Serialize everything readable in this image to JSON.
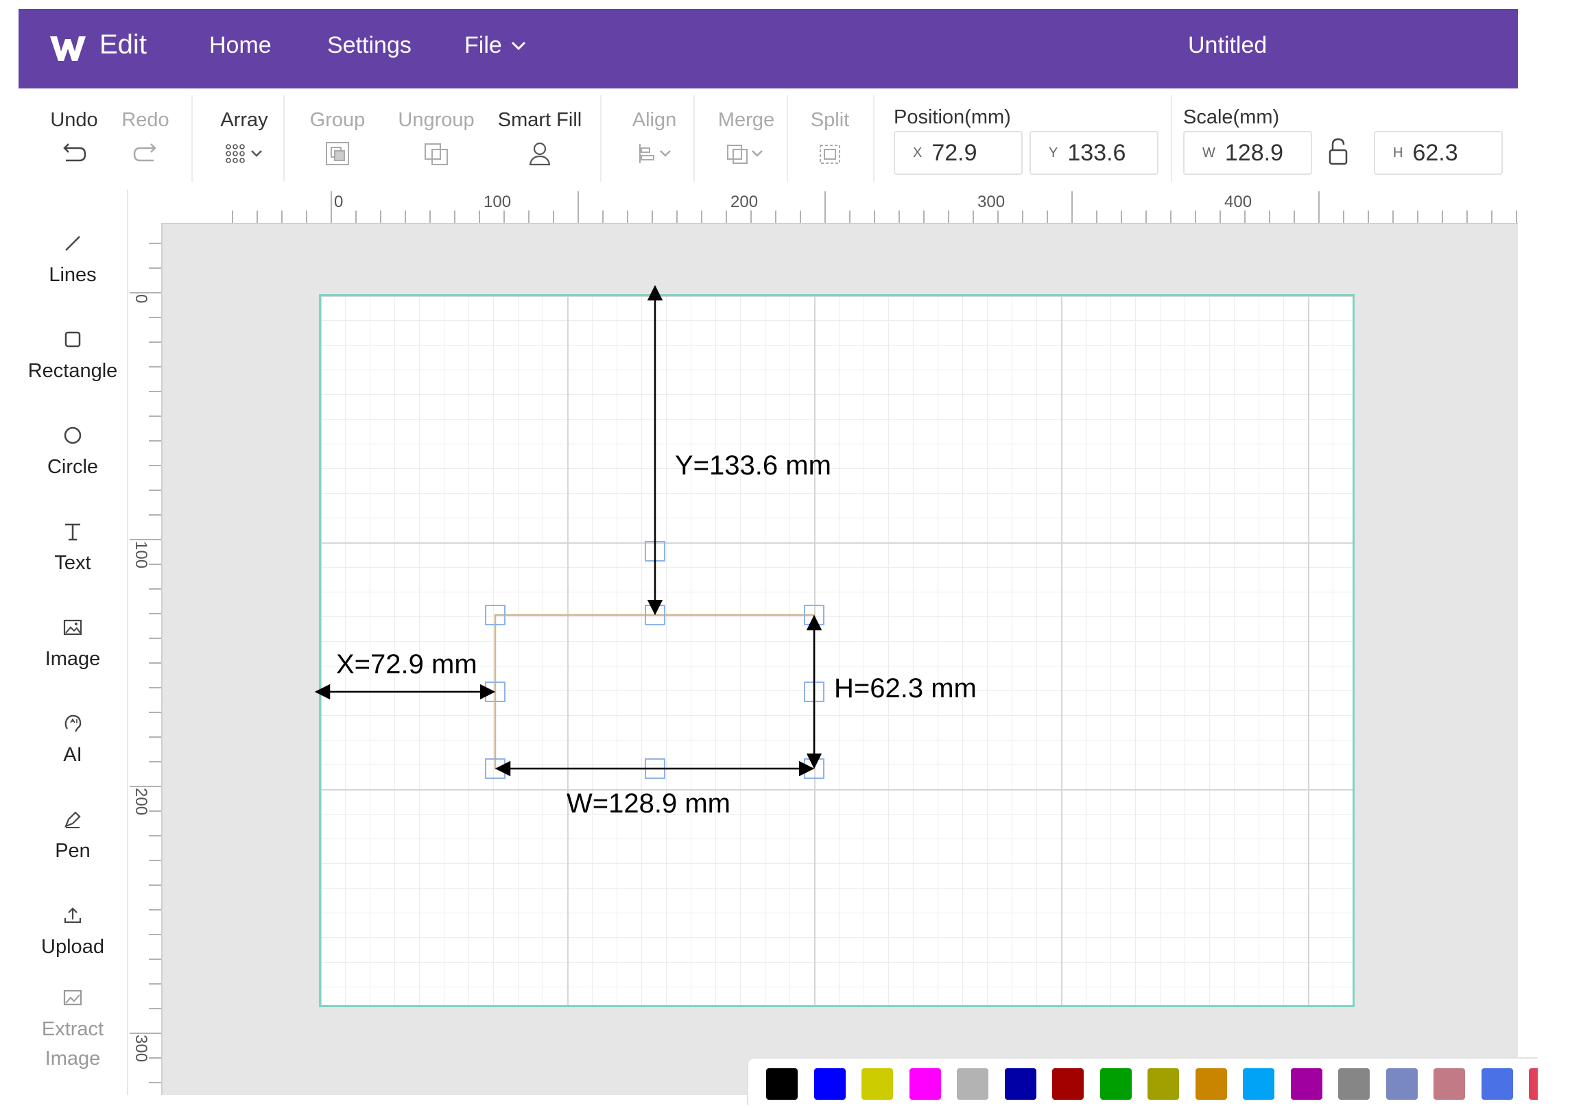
{
  "topbar": {
    "app_label": "Edit",
    "nav": {
      "home": "Home",
      "settings": "Settings",
      "file": "File"
    },
    "doc_title": "Untitled",
    "bg_color": "#6441a5"
  },
  "toolbar": {
    "undo": "Undo",
    "redo": "Redo",
    "array": "Array",
    "group": "Group",
    "ungroup": "Ungroup",
    "smart_fill": "Smart Fill",
    "align": "Align",
    "merge": "Merge",
    "split": "Split",
    "position_label": "Position(mm)",
    "pos_x_prefix": "X",
    "pos_x": "72.9",
    "pos_y_prefix": "Y",
    "pos_y": "133.6",
    "scale_label": "Scale(mm)",
    "scale_w_prefix": "W",
    "scale_w": "128.9",
    "scale_h_prefix": "H",
    "scale_h": "62.3"
  },
  "left_tools": {
    "lines": "Lines",
    "rectangle": "Rectangle",
    "circle": "Circle",
    "text": "Text",
    "image": "Image",
    "ai": "AI",
    "pen": "Pen",
    "upload": "Upload",
    "extract_1": "Extract",
    "extract_2": "Image"
  },
  "ruler": {
    "h": [
      "0",
      "100",
      "200",
      "300",
      "400"
    ],
    "v": [
      "0",
      "100",
      "200",
      "300"
    ]
  },
  "annotations": {
    "y": "Y=133.6 mm",
    "x": "X=72.9 mm",
    "h": "H=62.3 mm",
    "w": "W=128.9 mm"
  },
  "palette": [
    "#000000",
    "#0000ff",
    "#cccc00",
    "#ff00ff",
    "#b3b3b3",
    "#0000a6",
    "#a30000",
    "#009f00",
    "#a0a000",
    "#c98400",
    "#00a3f5",
    "#a100a1",
    "#868686",
    "#7a88c2",
    "#c27a86",
    "#4a72e6",
    "#e0405a"
  ]
}
